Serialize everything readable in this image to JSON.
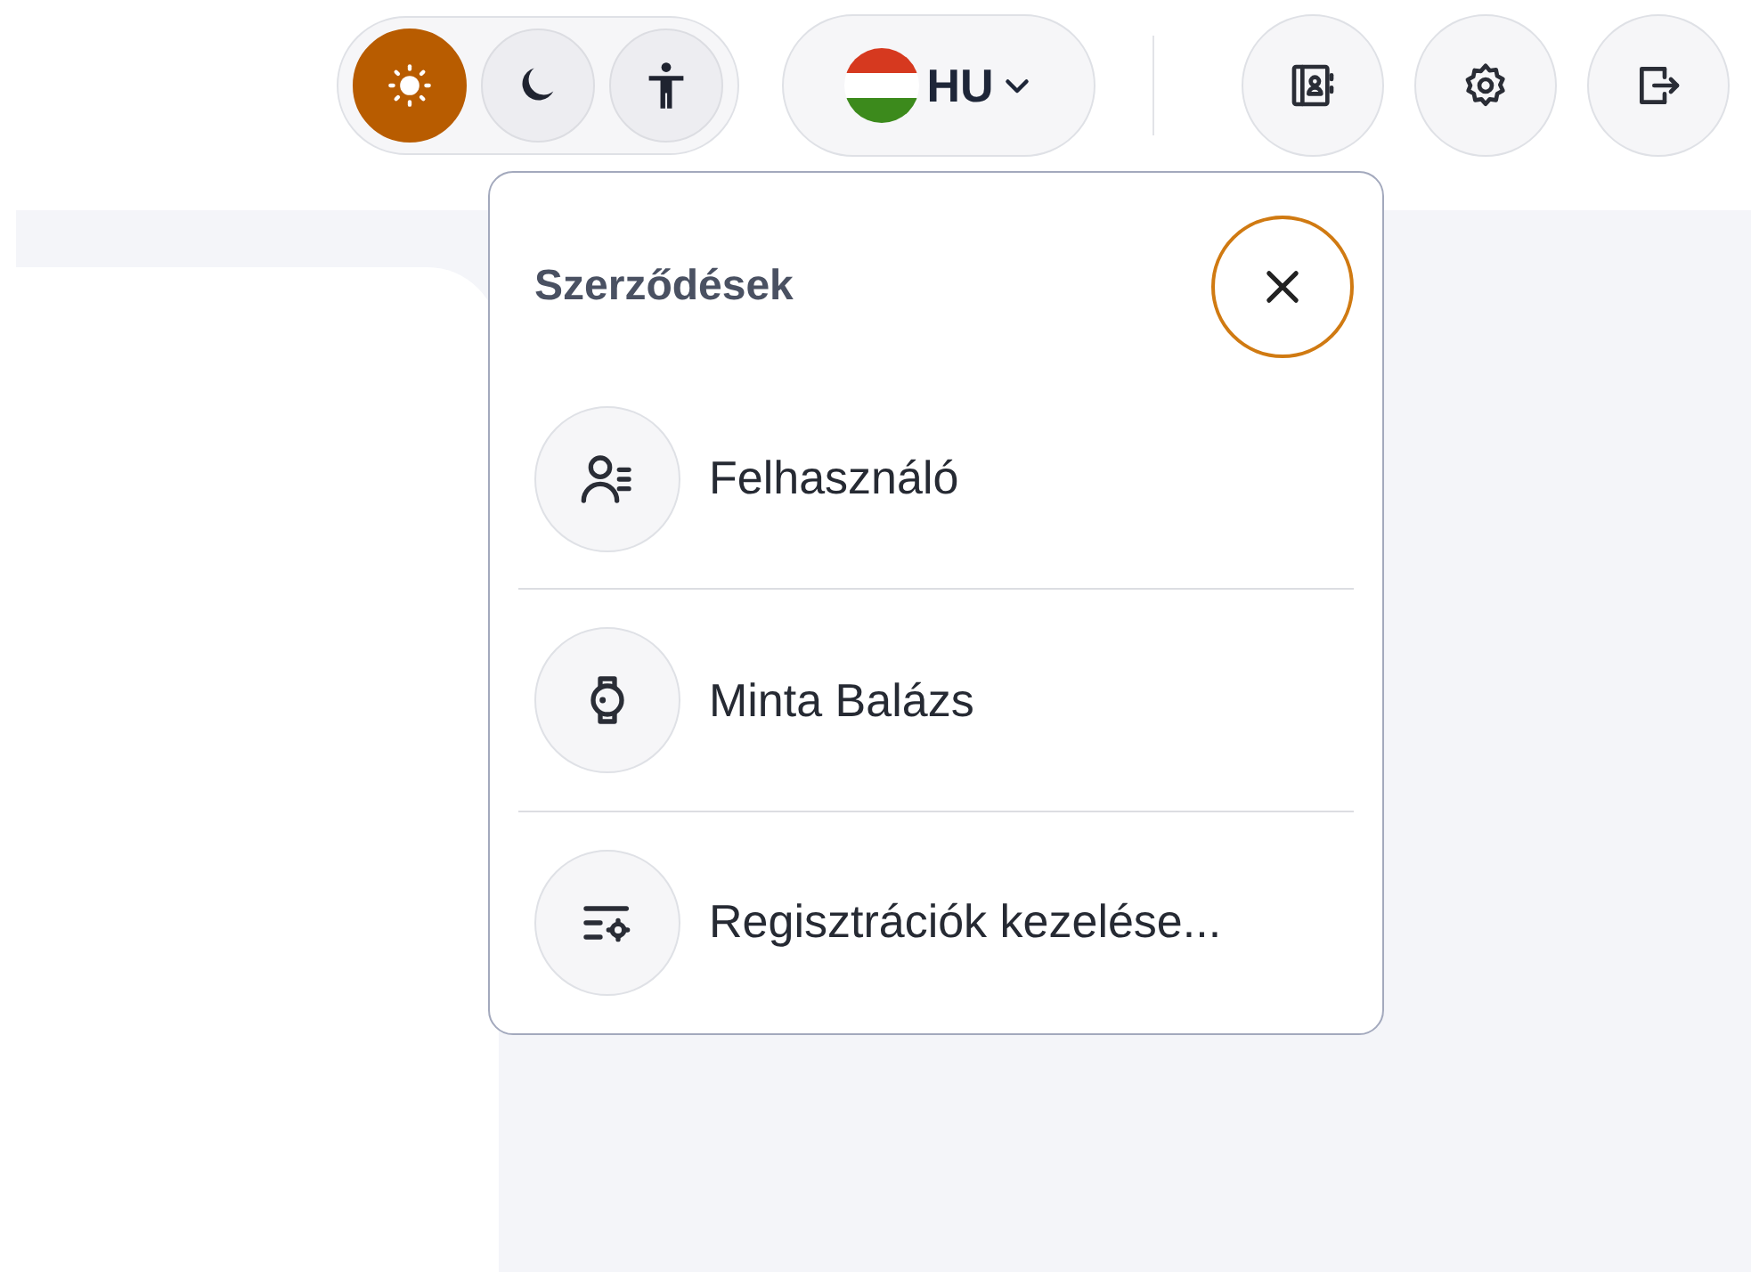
{
  "theme_switch": [
    {
      "kind": "light",
      "selected": true
    },
    {
      "kind": "dark",
      "selected": false
    },
    {
      "kind": "accessibility",
      "selected": false
    }
  ],
  "language": {
    "code": "HU"
  },
  "header_buttons": [
    {
      "kind": "contacts"
    },
    {
      "kind": "settings"
    },
    {
      "kind": "logout"
    }
  ],
  "menu": {
    "title": "Szerződések",
    "items": [
      {
        "kind": "user",
        "label": "Felhasználó"
      },
      {
        "kind": "watch",
        "label": "Minta Balázs"
      },
      {
        "kind": "manage",
        "label": "Regisztrációk kezelése..."
      }
    ]
  }
}
